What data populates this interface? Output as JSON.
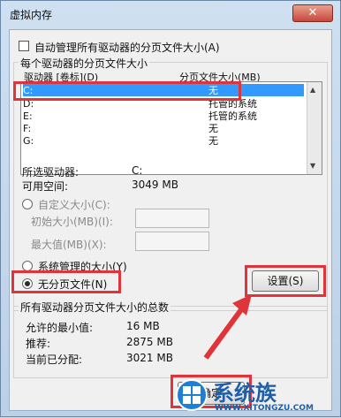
{
  "window": {
    "title": "虚拟内存",
    "close_glyph": "✕"
  },
  "auto_manage": {
    "label": "自动管理所有驱动器的分页文件大小(A)"
  },
  "group_each": {
    "title": "每个驱动器的分页文件大小",
    "header_drive": "驱动器 [卷标](D)",
    "header_size": "分页文件大小(MB)",
    "rows": [
      {
        "drive": "C:",
        "size": "无"
      },
      {
        "drive": "D:",
        "size": "托管的系统"
      },
      {
        "drive": "E:",
        "size": "托管的系统"
      },
      {
        "drive": "F:",
        "size": "无"
      },
      {
        "drive": "G:",
        "size": "无"
      }
    ]
  },
  "selected": {
    "drive_label": "所选驱动器:",
    "drive_value": "C:",
    "space_label": "可用空间:",
    "space_value": "3049 MB"
  },
  "custom": {
    "label": "自定义大小(C):",
    "initial_label": "初始大小(MB)(I):",
    "max_label": "最大值(MB)(X):"
  },
  "system_managed": {
    "label": "系统管理的大小(Y)"
  },
  "no_paging": {
    "label": "无分页文件(N)"
  },
  "set_button": {
    "label": "设置(S)"
  },
  "total": {
    "title": "所有驱动器分页文件大小的总数",
    "min_label": "允许的最小值:",
    "min_value": "16 MB",
    "rec_label": "推荐:",
    "rec_value": "2875 MB",
    "cur_label": "当前已分配:",
    "cur_value": "3021 MB"
  },
  "ok_button": {
    "label": "确定"
  },
  "watermark": {
    "text": "系统族",
    "url": "WWW.XITONGZU.COM"
  },
  "colors": {
    "highlight": "#e0343b",
    "arrow": "#e0343b",
    "selection": "#3399ff"
  }
}
